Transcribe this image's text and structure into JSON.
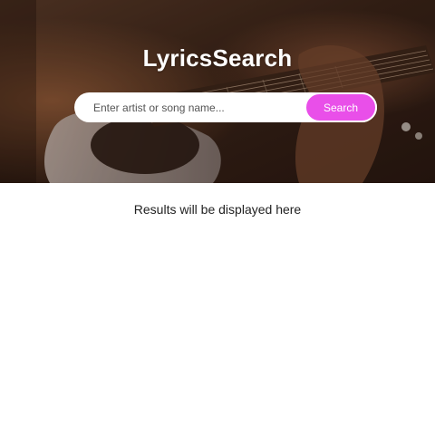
{
  "app": {
    "title": "LyricsSearch"
  },
  "search": {
    "placeholder": "Enter artist or song name...",
    "value": "",
    "button_label": "Search"
  },
  "results": {
    "placeholder_text": "Results will be displayed here"
  },
  "colors": {
    "accent": "#e94fe9",
    "hero_dark": "#3a2419"
  },
  "icons": {
    "hero_image": "guitar-photo"
  }
}
